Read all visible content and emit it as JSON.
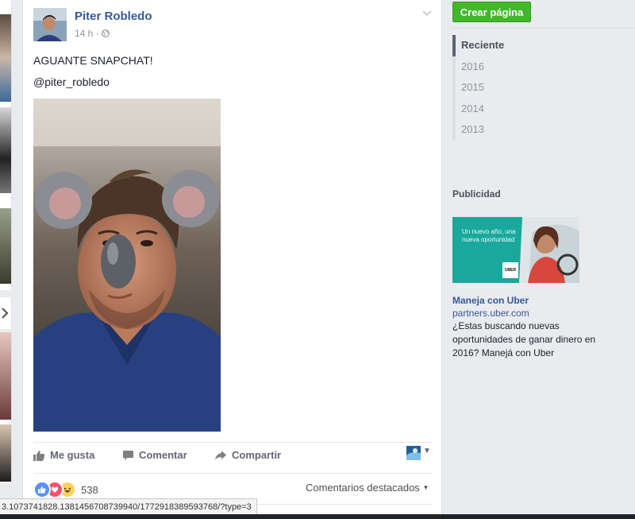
{
  "post": {
    "author": "Piter Robledo",
    "time": "14 h",
    "privacy_icon": "globe-icon",
    "text": "AGUANTE SNAPCHAT!",
    "handle": "@piter_robledo",
    "actions": {
      "like": "Me gusta",
      "comment": "Comentar",
      "share": "Compartir"
    },
    "reactions": {
      "icons": [
        "like-reaction-icon",
        "love-reaction-icon",
        "haha-reaction-icon"
      ],
      "count": "538"
    },
    "comments_filter": "Comentarios destacados"
  },
  "status_bar": {
    "url": "3.1073741828.1381456708739940/1772918389593768/?type=3"
  },
  "sidebar": {
    "create_page": "Crear página",
    "years": [
      "Reciente",
      "2016",
      "2015",
      "2014",
      "2013"
    ],
    "ads_title": "Publicidad",
    "ad": {
      "image_text": "Un nuevo año, una nueva oportunidad",
      "logo_text": "UBER",
      "title": "Maneja con Uber",
      "domain": "partners.uber.com",
      "body": "¿Estas buscando nuevas oportunidades de ganar dinero en 2016? Manejá con Uber"
    }
  },
  "colors": {
    "link_blue": "#365899",
    "create_button_green": "#42b72a",
    "page_background": "#e9ebee"
  }
}
